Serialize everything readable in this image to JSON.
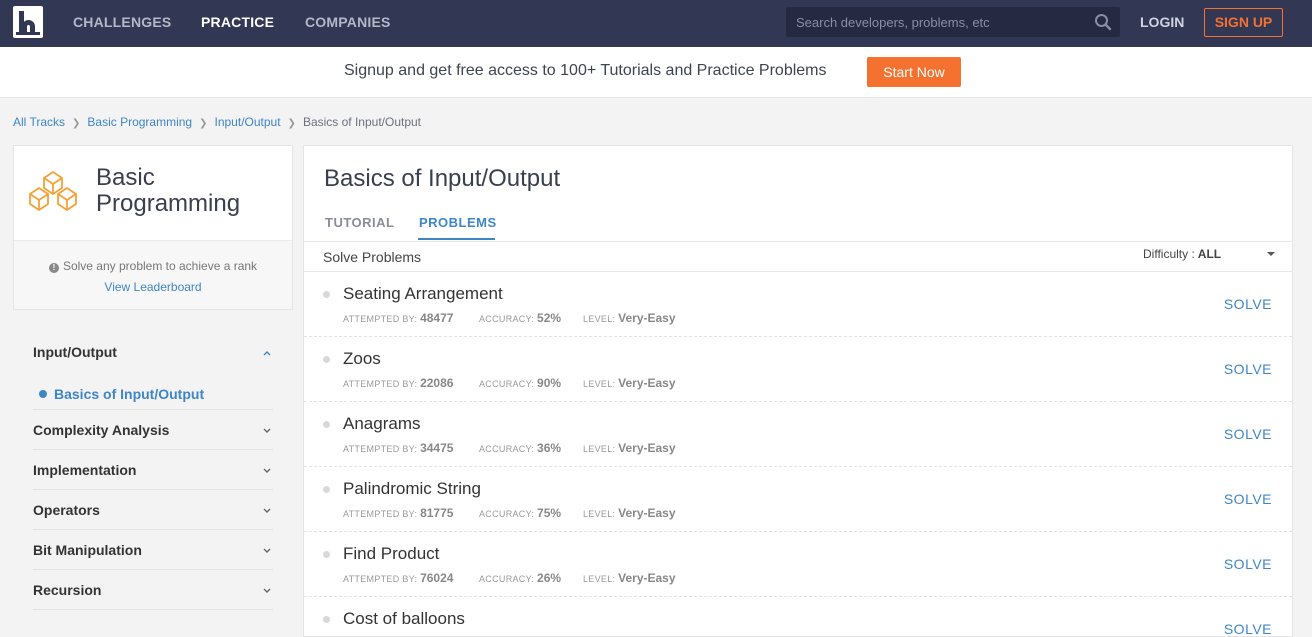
{
  "nav": {
    "items": [
      "CHALLENGES",
      "PRACTICE",
      "COMPANIES"
    ],
    "search_placeholder": "Search developers, problems, etc",
    "login": "LOGIN",
    "signup": "SIGN UP"
  },
  "promo": {
    "text": "Signup and get free access to 100+ Tutorials and Practice Problems",
    "button": "Start Now"
  },
  "breadcrumb": [
    "All Tracks",
    "Basic Programming",
    "Input/Output",
    "Basics of Input/Output"
  ],
  "track": {
    "title_line1": "Basic",
    "title_line2": "Programming",
    "rank_note": "Solve any problem to achieve a rank",
    "leaderboard_link": "View Leaderboard"
  },
  "sidebar": {
    "groups": [
      "Input/Output",
      "Complexity Analysis",
      "Implementation",
      "Operators",
      "Bit Manipulation",
      "Recursion"
    ],
    "active_subitem": "Basics of Input/Output"
  },
  "main": {
    "title": "Basics of Input/Output",
    "tabs": [
      "TUTORIAL",
      "PROBLEMS"
    ],
    "active_tab": "PROBLEMS",
    "solve_heading": "Solve Problems",
    "difficulty_label": "Difficulty :",
    "difficulty_value": "ALL"
  },
  "labels": {
    "attempted": "ATTEMPTED BY:",
    "accuracy": "ACCURACY:",
    "level": "LEVEL:",
    "solve": "SOLVE"
  },
  "problems": [
    {
      "name": "Seating Arrangement",
      "attempted": "48477",
      "accuracy": "52%",
      "level": "Very-Easy"
    },
    {
      "name": "Zoos",
      "attempted": "22086",
      "accuracy": "90%",
      "level": "Very-Easy"
    },
    {
      "name": "Anagrams",
      "attempted": "34475",
      "accuracy": "36%",
      "level": "Very-Easy"
    },
    {
      "name": "Palindromic String",
      "attempted": "81775",
      "accuracy": "75%",
      "level": "Very-Easy"
    },
    {
      "name": "Find Product",
      "attempted": "76024",
      "accuracy": "26%",
      "level": "Very-Easy"
    },
    {
      "name": "Cost of balloons",
      "attempted": "",
      "accuracy": "",
      "level": ""
    }
  ],
  "colors": {
    "nav_bg": "#323754",
    "accent_orange": "#f4712f",
    "link_blue": "#3f86c8"
  }
}
